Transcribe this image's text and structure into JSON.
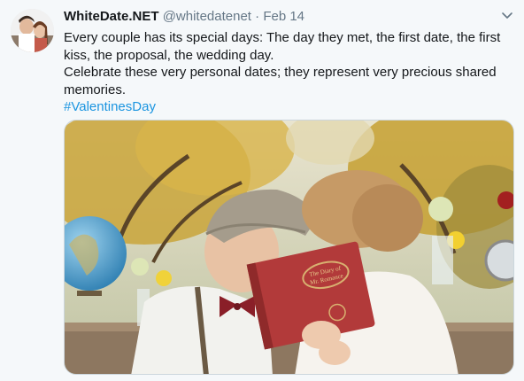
{
  "tweet": {
    "display_name": "WhiteDate.NET",
    "handle": "@whitedatenet",
    "separator": "·",
    "date": "Feb 14",
    "text_lines": [
      "Every couple has its special days: The day they met, the first date, the first",
      "kiss, the proposal, the wedding day.",
      "Celebrate these very personal dates; they represent very precious shared",
      "memories."
    ],
    "hashtag": "#ValentinesDay",
    "book_title_lines": [
      "The Diary of",
      "Mr. Romance"
    ]
  },
  "icons": {
    "avatar": "profile-photo-couple",
    "caret": "chevron-down-icon"
  },
  "colors": {
    "background": "#f5f8fa",
    "name": "#14171a",
    "secondary": "#657786",
    "link": "#1b95e0",
    "media_border": "#ccd6dd"
  }
}
